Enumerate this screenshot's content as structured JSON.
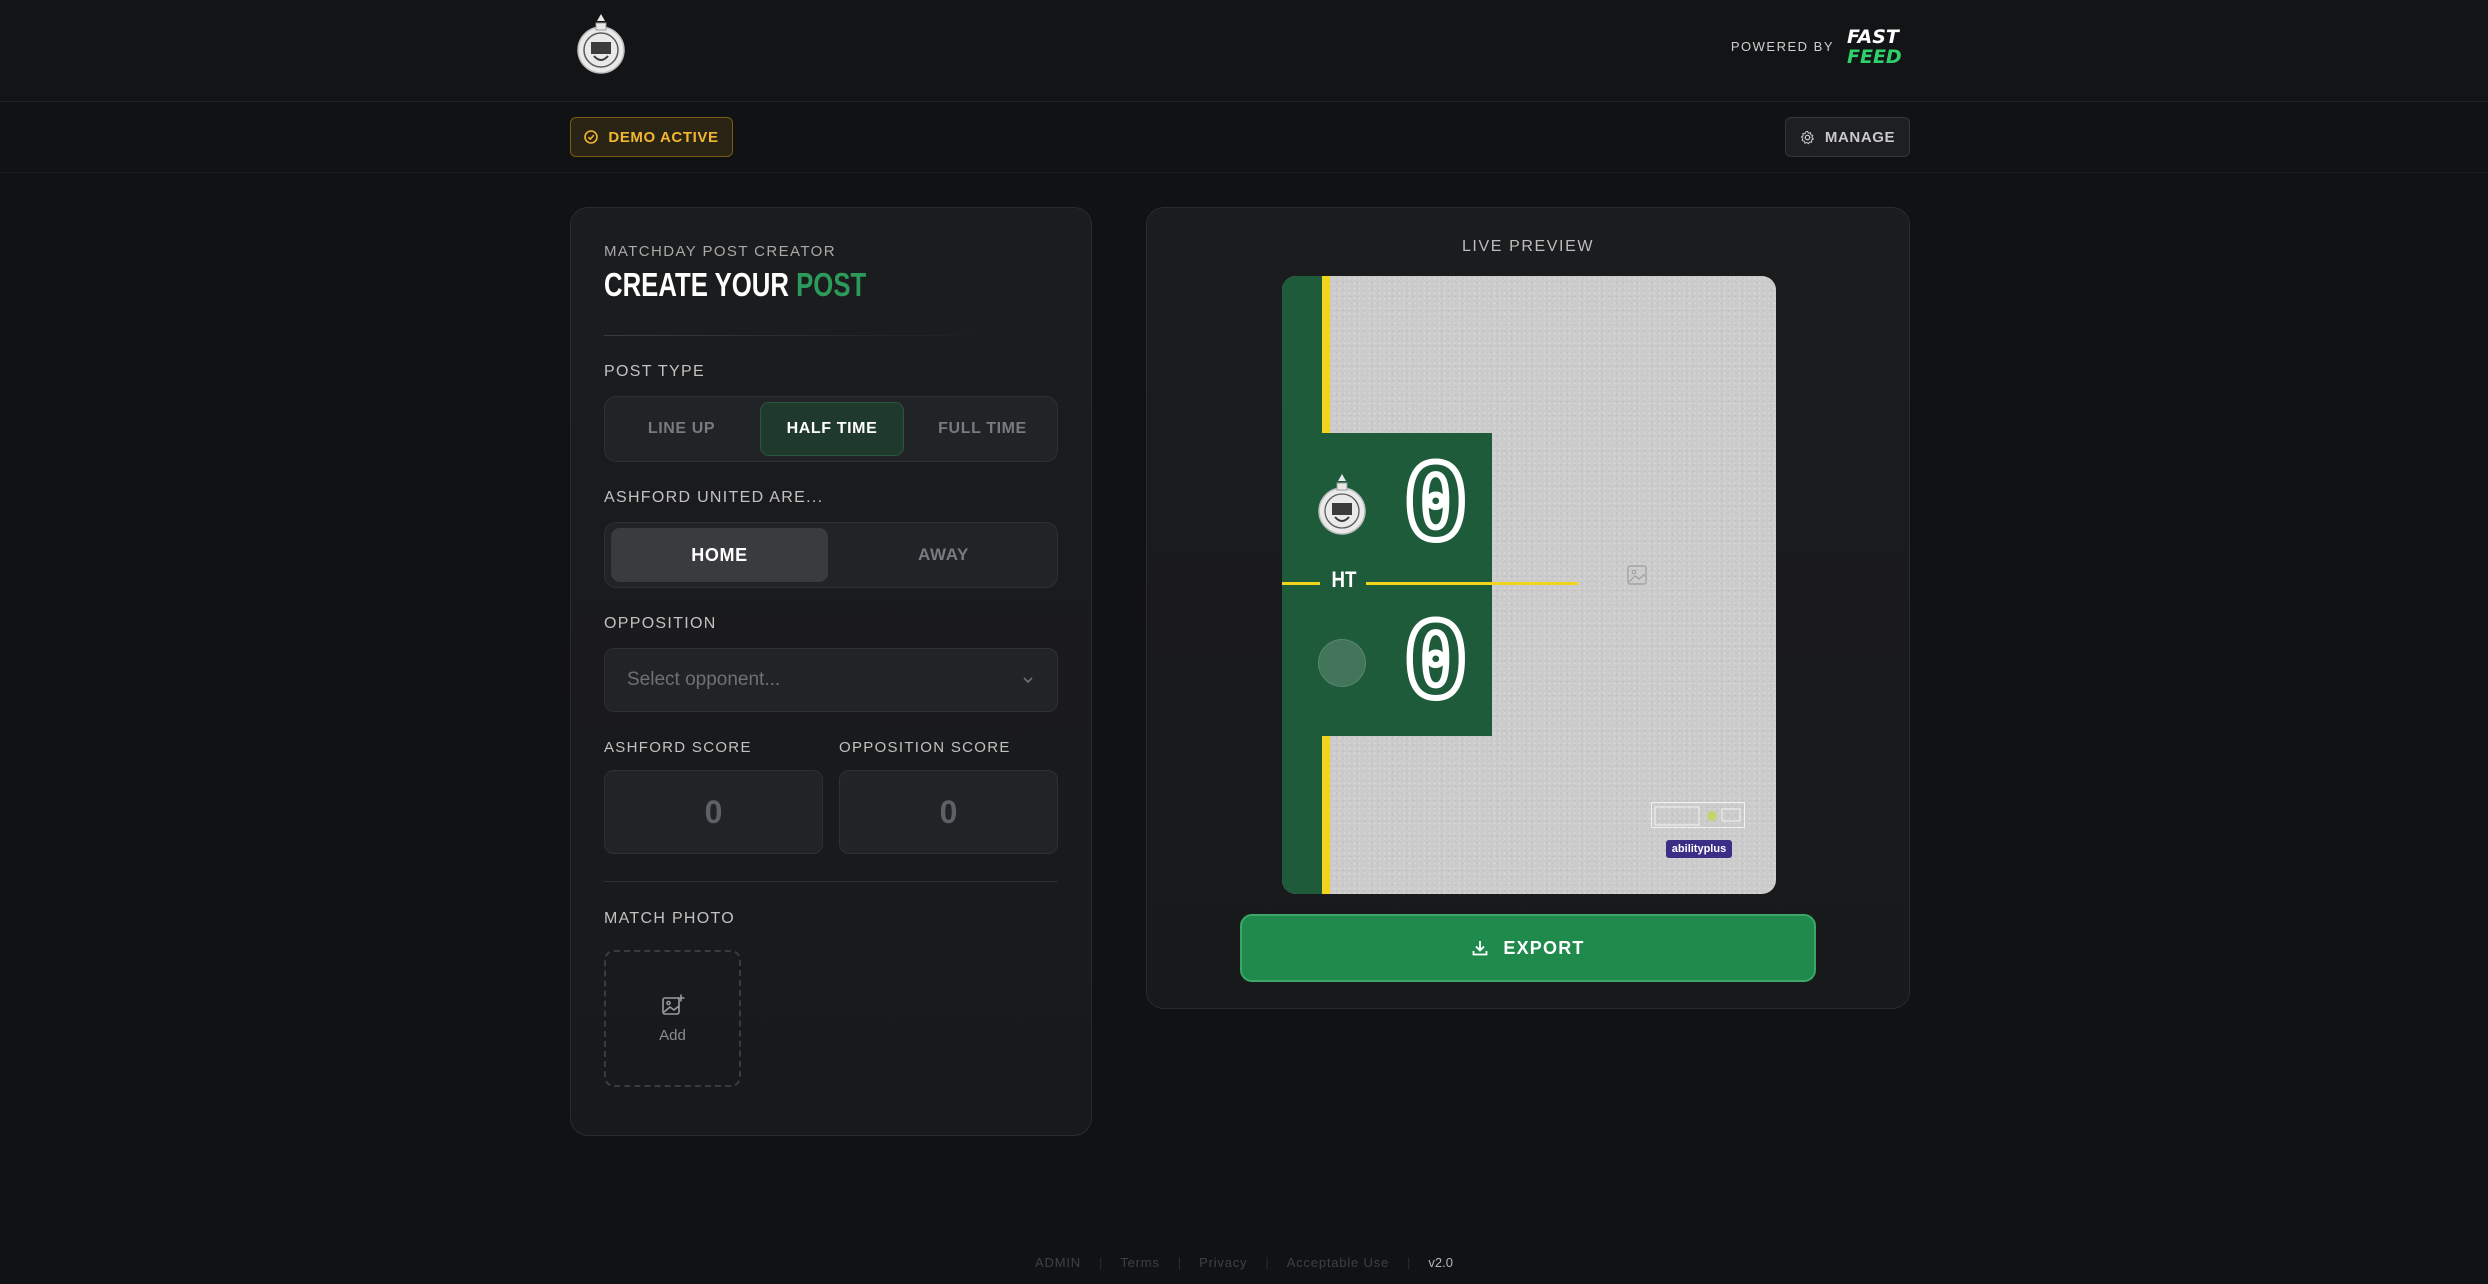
{
  "header": {
    "powered_by": "POWERED BY",
    "brand_top": "FAST",
    "brand_bottom": "FEED"
  },
  "actions": {
    "demo_badge": "DEMO ACTIVE",
    "manage": "MANAGE"
  },
  "form": {
    "eyebrow": "MATCHDAY POST CREATOR",
    "title_main": "CREATE YOUR",
    "title_accent": "POST",
    "post_type": {
      "label": "POST TYPE",
      "options": [
        "LINE UP",
        "HALF TIME",
        "FULL TIME"
      ],
      "selected": "HALF TIME"
    },
    "venue": {
      "label": "ASHFORD UNITED ARE...",
      "options": [
        "HOME",
        "AWAY"
      ],
      "selected": "HOME"
    },
    "opposition": {
      "label": "OPPOSITION",
      "placeholder": "Select opponent..."
    },
    "ashford_score": {
      "label": "ASHFORD SCORE",
      "value": "0"
    },
    "opposition_score": {
      "label": "OPPOSITION SCORE",
      "value": "0"
    },
    "match_photo": {
      "label": "MATCH PHOTO",
      "add_label": "Add"
    }
  },
  "preview": {
    "label": "LIVE PREVIEW",
    "period": "HT",
    "home_score": "0",
    "away_score": "0",
    "sponsor": "abilityplus",
    "export": "EXPORT",
    "colors": {
      "green": "#1e5b3b",
      "yellow": "#f2d41d",
      "export": "#1f8a4c"
    }
  },
  "footer": {
    "links": [
      "ADMIN",
      "Terms",
      "Privacy",
      "Acceptable Use"
    ],
    "version": "v2.0"
  },
  "colors": {
    "accent": "#2c9a5a",
    "demo": "#f2b632",
    "background": "#111214"
  }
}
